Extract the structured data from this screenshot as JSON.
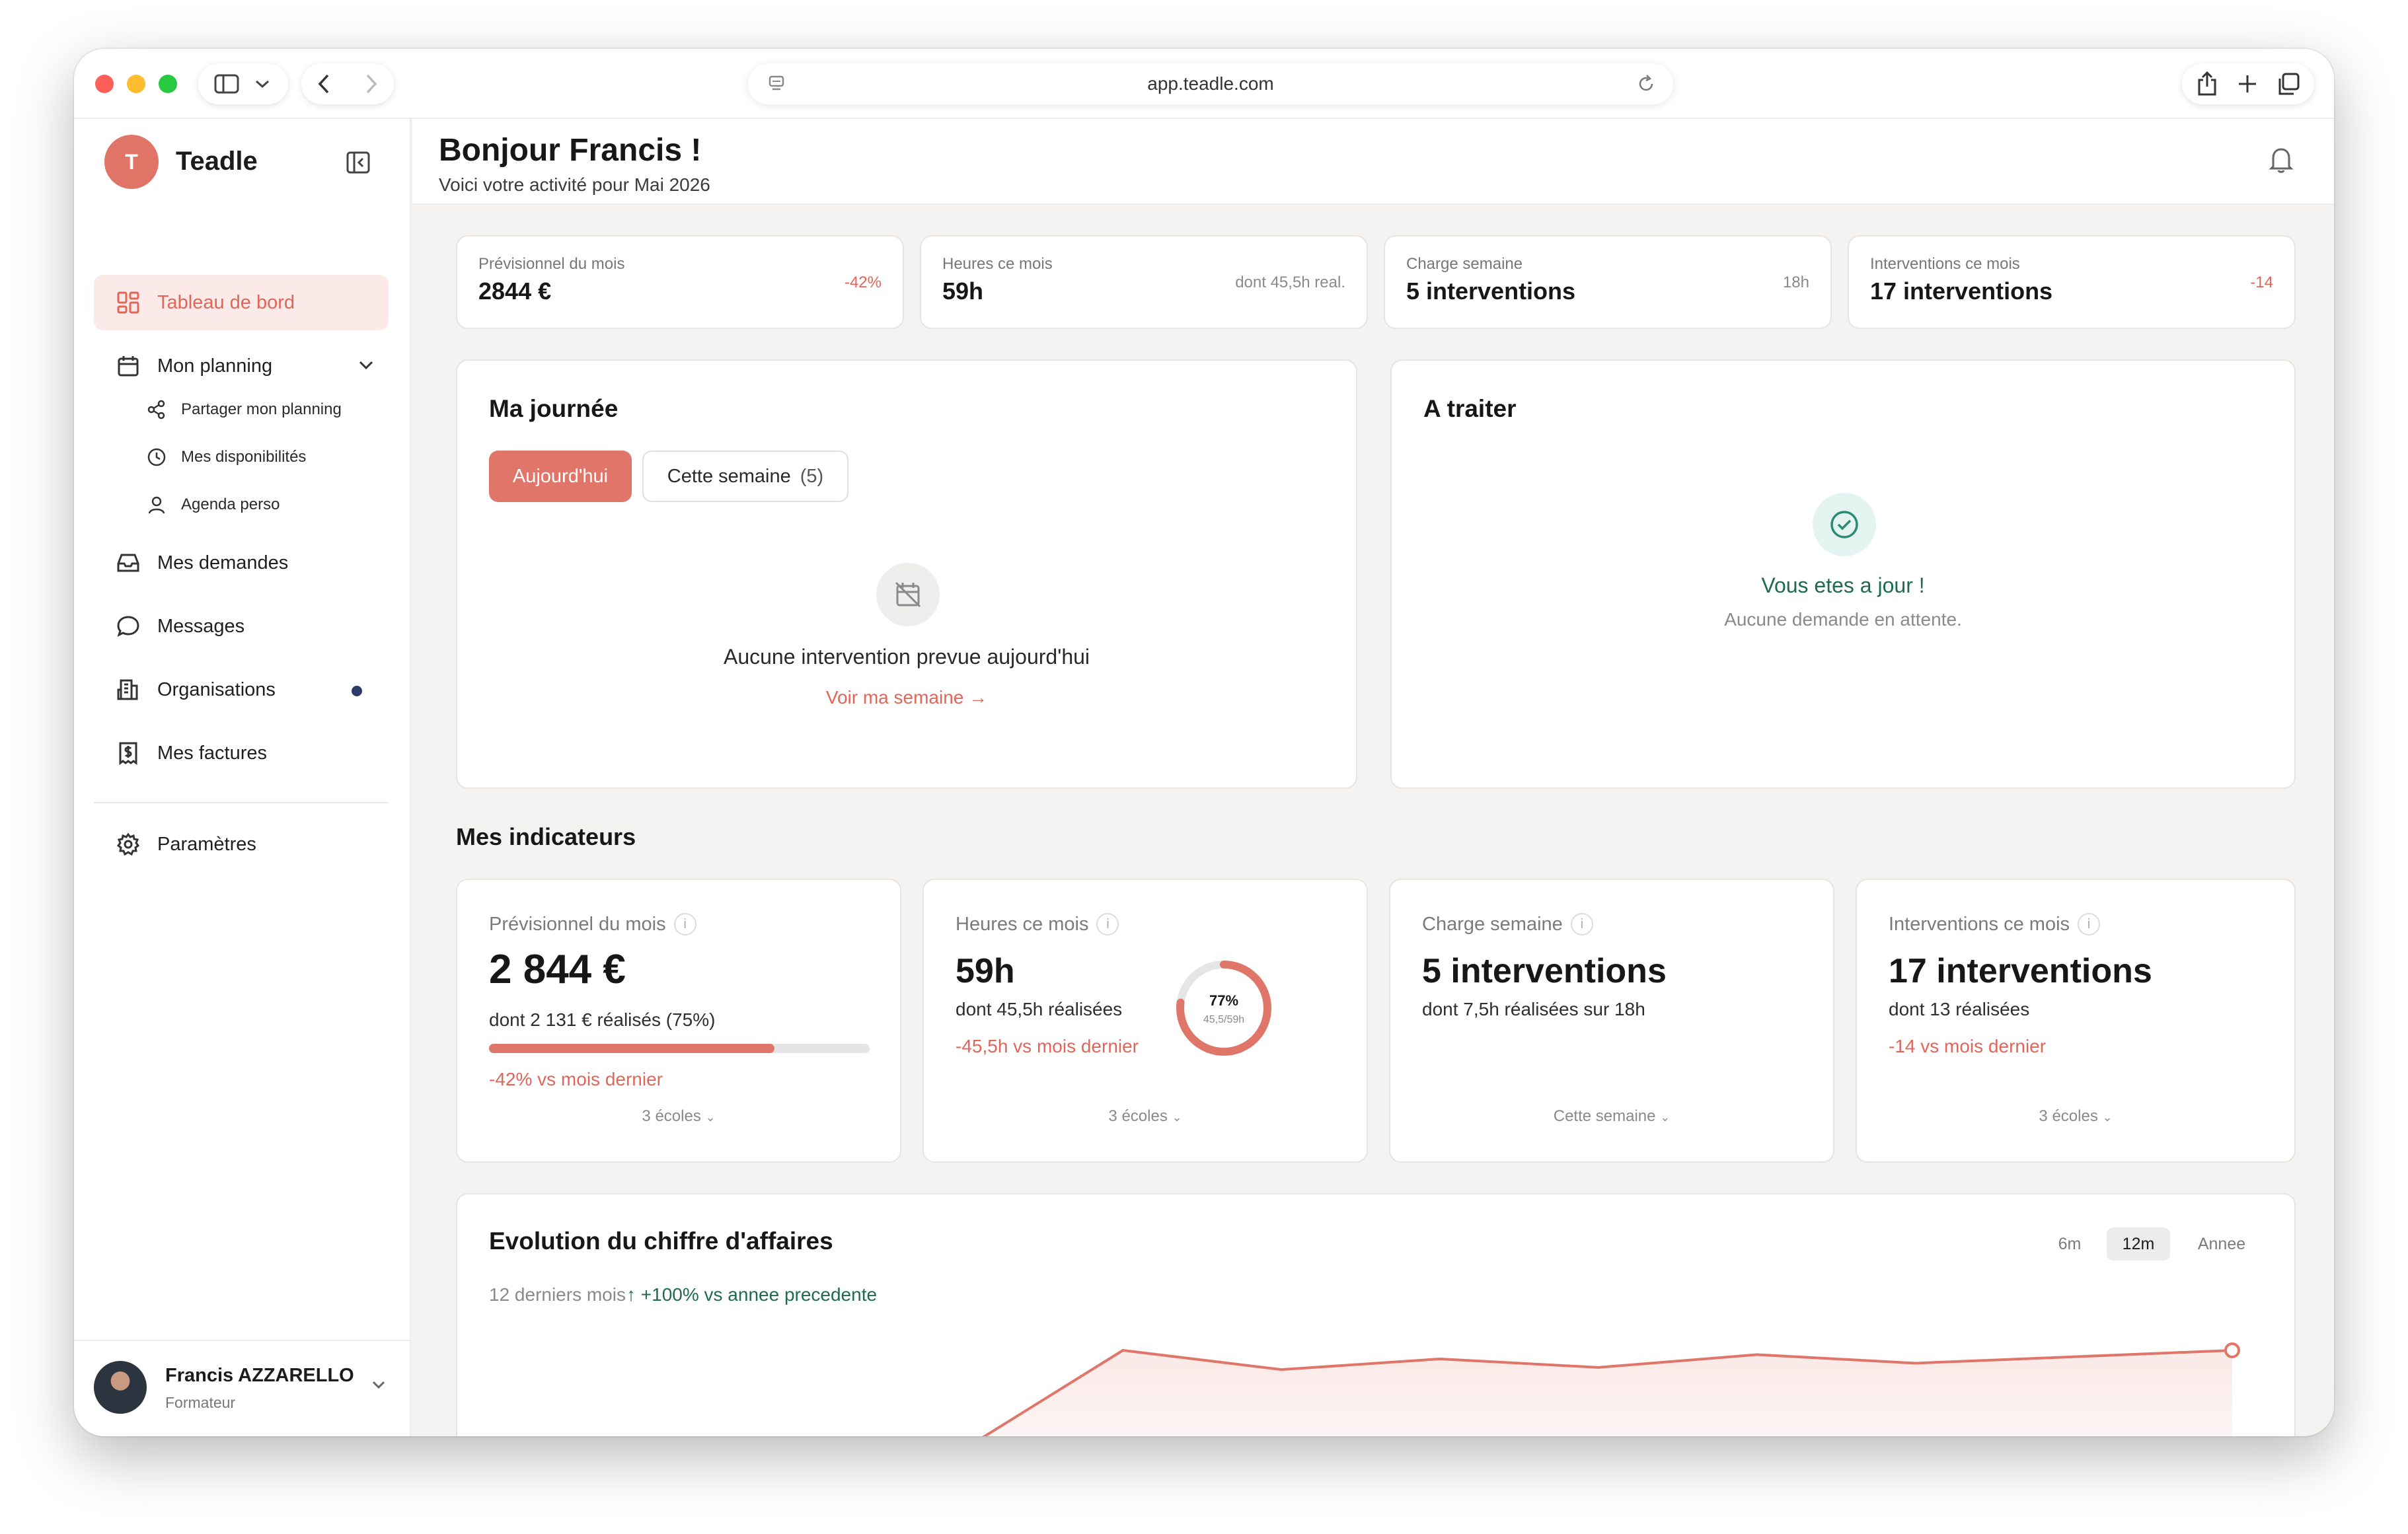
{
  "browser": {
    "url": "app.teadle.com"
  },
  "sidebar": {
    "logo_letter": "T",
    "brand": "Teadle",
    "items": [
      {
        "label": "Tableau de bord",
        "icon": "dashboard-icon"
      },
      {
        "label": "Mon planning",
        "icon": "calendar-icon"
      },
      {
        "label": "Mes demandes",
        "icon": "inbox-icon"
      },
      {
        "label": "Messages",
        "icon": "chat-icon"
      },
      {
        "label": "Organisations",
        "icon": "building-icon"
      },
      {
        "label": "Mes factures",
        "icon": "invoice-icon"
      },
      {
        "label": "Paramètres",
        "icon": "gear-icon"
      }
    ],
    "subitems": [
      {
        "label": "Partager mon planning",
        "icon": "share-icon"
      },
      {
        "label": "Mes disponibilités",
        "icon": "clock-icon"
      },
      {
        "label": "Agenda perso",
        "icon": "user-icon"
      }
    ],
    "user": {
      "name": "Francis AZZARELLO",
      "role": "Formateur"
    }
  },
  "header": {
    "title": "Bonjour Francis !",
    "subtitle": "Voici votre activité pour Mai 2026"
  },
  "stats": [
    {
      "label": "Prévisionnel du mois",
      "value": "2844 €",
      "aside": "-42%",
      "aside_color": "#e0665a"
    },
    {
      "label": "Heures ce mois",
      "value": "59h",
      "aside": "dont 45,5h real.",
      "aside_color": "#8a8a8e"
    },
    {
      "label": "Charge semaine",
      "value": "5 interventions",
      "aside": "18h",
      "aside_color": "#8a8a8e"
    },
    {
      "label": "Interventions ce mois",
      "value": "17 interventions",
      "aside": "-14",
      "aside_color": "#e0665a"
    }
  ],
  "journee": {
    "title": "Ma journée",
    "tab_today": "Aujourd'hui",
    "tab_week": "Cette semaine",
    "tab_week_count": "(5)",
    "empty_text": "Aucune intervention prevue aujourd'hui",
    "link": "Voir ma semaine →"
  },
  "a_traiter": {
    "title": "A traiter",
    "ok_title": "Vous etes a jour !",
    "ok_sub": "Aucune demande en attente."
  },
  "indicateurs": {
    "title": "Mes indicateurs",
    "info_glyph": "i",
    "cards": [
      {
        "label": "Prévisionnel du mois",
        "value": "2 844 €",
        "sub": "dont 2 131 € réalisés (75%)",
        "neg": "-42% vs mois dernier",
        "foot": "3 écoles",
        "progress": 0.75
      },
      {
        "label": "Heures ce mois",
        "value": "59h",
        "sub": "dont 45,5h réalisées",
        "neg": "-45,5h vs mois dernier",
        "foot": "3 écoles",
        "donut_pct": "77%",
        "donut_sub": "45,5/59h",
        "donut_fraction": 0.77
      },
      {
        "label": "Charge semaine",
        "value": "5 interventions",
        "sub": "dont 7,5h réalisées sur 18h",
        "neg": "",
        "foot": "Cette semaine"
      },
      {
        "label": "Interventions ce mois",
        "value": "17 interventions",
        "sub": "dont 13 réalisées",
        "neg": "-14 vs mois dernier",
        "foot": "3 écoles"
      }
    ]
  },
  "revenue": {
    "title": "Evolution du chiffre d'affaires",
    "period_label": "12 derniers mois",
    "trend": "↑ +100% vs annee precedente",
    "ranges": [
      "6m",
      "12m",
      "Annee"
    ],
    "active_range": "12m"
  },
  "chart_data": {
    "type": "area",
    "title": "Evolution du chiffre d'affaires",
    "xlabel": "",
    "ylabel": "",
    "series": [
      {
        "values": [
          0,
          0,
          0,
          0.08,
          1.0,
          0.82,
          0.92,
          0.84,
          0.96,
          0.88,
          0.94,
          1.0
        ]
      }
    ],
    "grid": false,
    "note_units": "relative scale, no axis values printed"
  },
  "colors": {
    "accent": "#e0766a",
    "accent_text": "#e0665a",
    "green": "#1f6b52",
    "bg": "#f4f3f1"
  }
}
